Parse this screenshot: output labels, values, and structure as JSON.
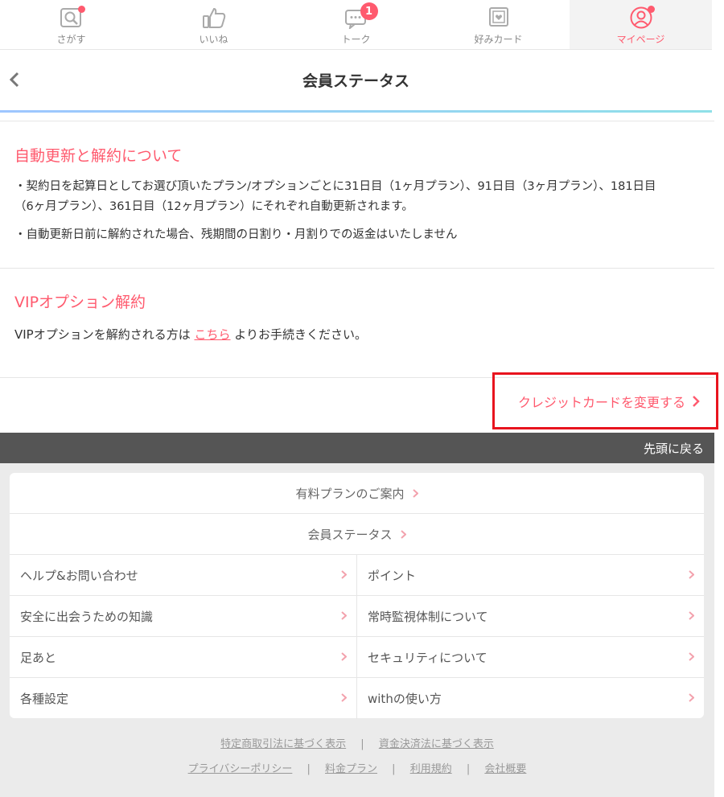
{
  "nav": {
    "items": [
      {
        "label": "さがす",
        "icon": "search-icon"
      },
      {
        "label": "いいね",
        "icon": "thumbs-up-icon"
      },
      {
        "label": "トーク",
        "icon": "chat-icon",
        "badge": "1"
      },
      {
        "label": "好みカード",
        "icon": "card-icon"
      },
      {
        "label": "マイページ",
        "icon": "user-icon"
      }
    ]
  },
  "header": {
    "title": "会員ステータス"
  },
  "renewal": {
    "title": "自動更新と解約について",
    "bullets": [
      "・契約日を起算日としてお選び頂いたプラン/オプションごとに31日目（1ヶ月プラン）、91日目（3ヶ月プラン）、181日目（6ヶ月プラン）、361日目（12ヶ月プラン）にそれぞれ自動更新されます。",
      "・自動更新日前に解約された場合、残期間の日割り・月割りでの返金はいたしません"
    ]
  },
  "vip": {
    "title": "VIPオプション解約",
    "text_before": "VIPオプションを解約される方は ",
    "link": "こちら",
    "text_after": " よりお手続きください。"
  },
  "credit_card_link": "クレジットカードを変更する",
  "back_to_top": "先頭に戻る",
  "footer_menu": {
    "full": [
      "有料プランのご案内",
      "会員ステータス"
    ],
    "grid": [
      [
        "ヘルプ&お問い合わせ",
        "ポイント"
      ],
      [
        "安全に出会うための知識",
        "常時監視体制について"
      ],
      [
        "足あと",
        "セキュリティについて"
      ],
      [
        "各種設定",
        "withの使い方"
      ]
    ]
  },
  "legal": {
    "row1": [
      "特定商取引法に基づく表示",
      "資金決済法に基づく表示"
    ],
    "row2": [
      "プライバシーポリシー",
      "料金プラン",
      "利用規約",
      "会社概要"
    ],
    "separator": "|"
  },
  "colors": {
    "accent": "#ff5a6e",
    "highlight_box": "#e8141e",
    "dark_bar": "#555555"
  }
}
